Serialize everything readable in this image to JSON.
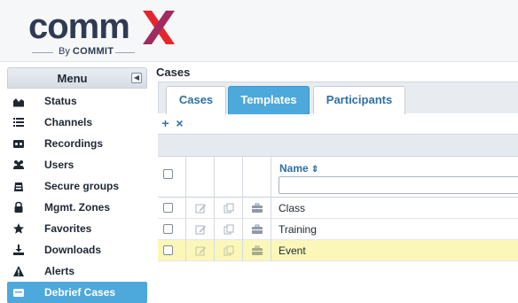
{
  "app": {
    "logo_word": "comm",
    "logo_sub_prefix": "By",
    "logo_sub_brand": "COMMIT",
    "accent": "#4da8dc",
    "logo_x_colors": [
      "#e5262c",
      "#a12a5e"
    ]
  },
  "sidebar": {
    "title": "Menu",
    "collapse_icon": "chevron-left-icon",
    "items": [
      {
        "label": "Status",
        "icon": "chart-icon"
      },
      {
        "label": "Channels",
        "icon": "list-icon"
      },
      {
        "label": "Recordings",
        "icon": "tape-icon"
      },
      {
        "label": "Users",
        "icon": "users-icon"
      },
      {
        "label": "Secure groups",
        "icon": "vault-icon"
      },
      {
        "label": "Mgmt. Zones",
        "icon": "lock-icon"
      },
      {
        "label": "Favorites",
        "icon": "star-icon"
      },
      {
        "label": "Downloads",
        "icon": "download-icon"
      },
      {
        "label": "Alerts",
        "icon": "warning-icon"
      },
      {
        "label": "Debrief Cases",
        "icon": "folder-icon",
        "active": true
      }
    ]
  },
  "main": {
    "title": "Cases",
    "tabs": [
      {
        "label": "Cases",
        "active": false
      },
      {
        "label": "Templates",
        "active": true
      },
      {
        "label": "Participants",
        "active": false
      }
    ],
    "toolbar": {
      "add_label": "+",
      "delete_label": "×"
    },
    "grid": {
      "column_name": "Name",
      "sort_icon": "sort-icon",
      "filter_value": "",
      "row_icons": [
        "edit-icon",
        "copy-icon",
        "briefcase-icon"
      ],
      "rows": [
        {
          "name": "Class",
          "highlighted": false
        },
        {
          "name": "Training",
          "highlighted": false
        },
        {
          "name": "Event",
          "highlighted": true
        }
      ]
    }
  }
}
